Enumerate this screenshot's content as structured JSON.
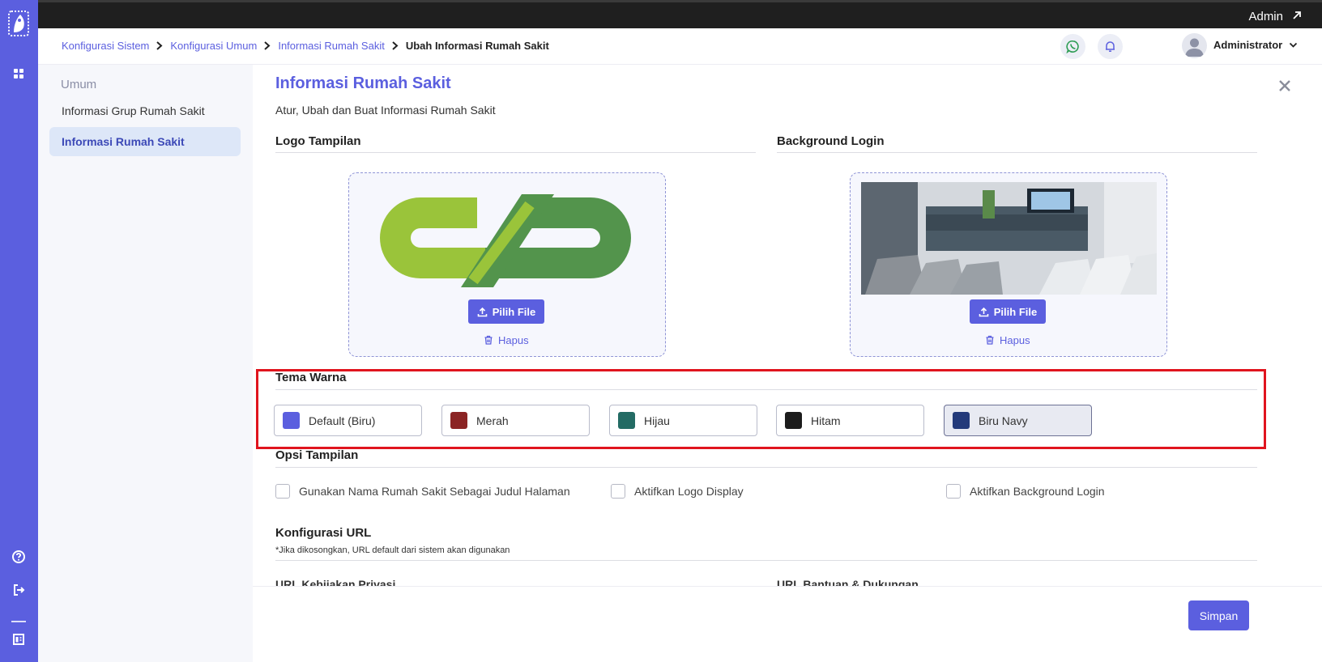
{
  "topbar": {
    "admin_label": "Admin"
  },
  "breadcrumb": [
    "Konfigurasi Sistem",
    "Konfigurasi Umum",
    "Informasi Rumah Sakit",
    "Ubah Informasi Rumah Sakit"
  ],
  "header": {
    "user_name": "Administrator"
  },
  "sidebar": {
    "group": "Umum",
    "items": [
      {
        "label": "Informasi Grup Rumah Sakit"
      },
      {
        "label": "Informasi Rumah Sakit"
      }
    ]
  },
  "main": {
    "title": "Informasi Rumah Sakit",
    "subtitle": "Atur, Ubah dan Buat Informasi Rumah Sakit",
    "logo_section": "Logo Tampilan",
    "background_section": "Background Login",
    "choose_file": "Pilih File",
    "delete": "Hapus",
    "theme_section": "Tema Warna",
    "themes": [
      {
        "label": "Default (Biru)",
        "color": "#5b5fdf"
      },
      {
        "label": "Merah",
        "color": "#8b2424"
      },
      {
        "label": "Hijau",
        "color": "#236b64"
      },
      {
        "label": "Hitam",
        "color": "#1c1c1c"
      },
      {
        "label": "Biru Navy",
        "color": "#233a7a"
      }
    ],
    "selected_theme": "Biru Navy",
    "options_section": "Opsi Tampilan",
    "options": [
      {
        "label": "Gunakan Nama Rumah Sakit Sebagai Judul Halaman"
      },
      {
        "label": "Aktifkan Logo Display"
      },
      {
        "label": "Aktifkan Background Login"
      }
    ],
    "url_section": "Konfigurasi URL",
    "url_note": "*Jika dikosongkan, URL default dari sistem akan digunakan",
    "url_privacy_label": "URL Kebijakan Privasi",
    "url_help_label": "URL Bantuan & Dukungan",
    "save": "Simpan"
  },
  "colors": {
    "accent": "#5b5fdf",
    "highlight": "#e0141e",
    "logo_light_green": "#9ac43a",
    "logo_dark_green": "#53944c"
  }
}
